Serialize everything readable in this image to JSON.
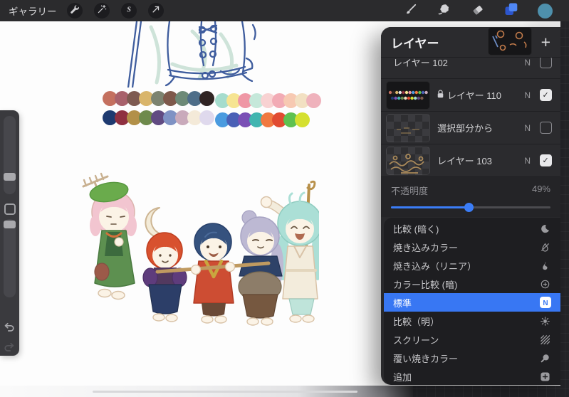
{
  "topbar": {
    "gallery_label": "ギャラリー",
    "left_tools": [
      {
        "icon": "wrench-icon"
      },
      {
        "icon": "magic-wand-icon"
      },
      {
        "icon": "selection-s-icon"
      },
      {
        "icon": "transform-arrow-icon"
      }
    ],
    "right_tools": [
      {
        "icon": "paint-brush-icon"
      },
      {
        "icon": "smudge-finger-icon"
      },
      {
        "icon": "eraser-icon"
      },
      {
        "icon": "layers-squares-icon",
        "active": true,
        "color": "#3D6EF3"
      },
      {
        "icon": "color-swatch-circle",
        "color": "#4E90AC"
      }
    ]
  },
  "sidebar": {
    "controls": [
      "brush-size-slider",
      "modify-button",
      "brush-opacity-slider",
      "undo-icon",
      "redo-icon"
    ]
  },
  "layers_panel": {
    "title": "レイヤー",
    "add_button_label": "+",
    "layers": [
      {
        "name": "レイヤー 102",
        "blend_badge": "N",
        "visible": false,
        "locked": false,
        "thumb": "sketch"
      },
      {
        "name": "レイヤー 110",
        "blend_badge": "N",
        "visible": true,
        "locked": true,
        "thumb": "palette"
      },
      {
        "name": "選択部分から",
        "blend_badge": "N",
        "visible": false,
        "locked": false,
        "thumb": "checker"
      },
      {
        "name": "レイヤー 103",
        "blend_badge": "N",
        "visible": true,
        "locked": false,
        "thumb": "checkerArt"
      }
    ],
    "opacity": {
      "label": "不透明度",
      "value": "49%",
      "percent": 49
    },
    "blend_modes": [
      {
        "label": "比較 (暗く)",
        "icon": "crescent-moon-icon",
        "selected": false
      },
      {
        "label": "焼き込みカラー",
        "icon": "slashed-drop-icon",
        "selected": false
      },
      {
        "label": "焼き込み（リニア）",
        "icon": "flame-icon",
        "selected": false
      },
      {
        "label": "カラー比較 (暗)",
        "icon": "circle-plus-icon",
        "selected": false
      },
      {
        "label": "標準",
        "icon": "n-badge-icon",
        "selected": true
      },
      {
        "label": "比較（明）",
        "icon": "sun-icon",
        "selected": false
      },
      {
        "label": "スクリーン",
        "icon": "diagonal-stripes-icon",
        "selected": false
      },
      {
        "label": "覆い焼きカラー",
        "icon": "loupe-icon",
        "selected": false
      },
      {
        "label": "追加",
        "icon": "plus-square-icon",
        "selected": false
      }
    ],
    "selected_blend_color": "#3877F3"
  },
  "canvas": {
    "palette_left": [
      [
        "#C4705F",
        "#A8616B",
        "#7E5A51",
        "#D9B56B",
        "#7C8370",
        "#7E594B",
        "#6D8A77",
        "#4E6E89",
        "#302423"
      ],
      [
        "#1E3A70",
        "#8F3040",
        "#B29048",
        "#6E8A4C",
        "#614B82",
        "#7F92C4",
        "#C9AABB",
        "#F4EAD9",
        "#DFD9ED"
      ]
    ],
    "palette_right": [
      [
        "#A5DCCD",
        "#F6E492",
        "#EF97A5",
        "#C5E8DA",
        "#F8D2D2",
        "#F2ABB5",
        "#F7C9B2",
        "#F2E0C2",
        "#EFB2BC"
      ],
      [
        "#4A9BDF",
        "#4A60B6",
        "#7A50B5",
        "#41B5B0",
        "#F07940",
        "#E14B31",
        "#5FC150",
        "#D5E030"
      ]
    ],
    "artwork": [
      "line-sketch-torso",
      "chibi-characters-group"
    ]
  }
}
